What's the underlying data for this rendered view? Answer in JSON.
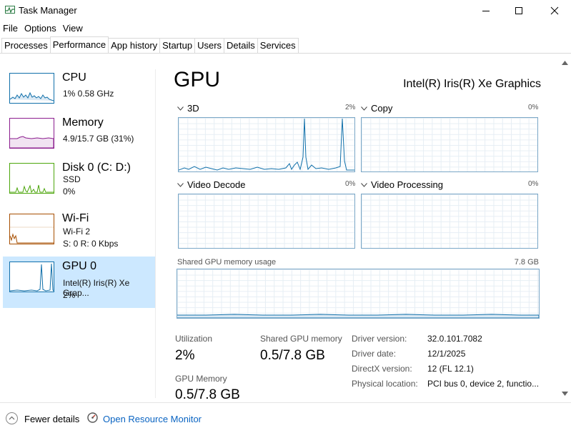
{
  "window": {
    "title": "Task Manager",
    "app_icon": "task-manager-icon",
    "controls": [
      "minimize-icon",
      "maximize-icon",
      "close-icon"
    ]
  },
  "menu": [
    "File",
    "Options",
    "View"
  ],
  "tabs": [
    "Processes",
    "Performance",
    "App history",
    "Startup",
    "Users",
    "Details",
    "Services"
  ],
  "active_tab": "Performance",
  "sidebar": {
    "items": [
      {
        "title": "CPU",
        "line1": "1%  0.58 GHz",
        "line2": "",
        "line3": "",
        "color": "#1170aa"
      },
      {
        "title": "Memory",
        "line1": "4.9/15.7 GB (31%)",
        "line2": "",
        "line3": "",
        "color": "#8b1d8e"
      },
      {
        "title": "Disk 0 (C: D:)",
        "line1": "SSD",
        "line2": "0%",
        "line3": "",
        "color": "#4da60c"
      },
      {
        "title": "Wi-Fi",
        "line1": "Wi-Fi 2",
        "line2": "S: 0  R: 0 Kbps",
        "line3": "",
        "color": "#a74f01"
      },
      {
        "title": "GPU 0",
        "line1": "Intel(R) Iris(R) Xe Grap...",
        "line2": "2%",
        "line3": "",
        "color": "#1170aa"
      }
    ],
    "selected": "GPU 0"
  },
  "main": {
    "title": "GPU",
    "model": "Intel(R) Iris(R) Xe Graphics",
    "engines": [
      {
        "name": "3D",
        "percent": "2%"
      },
      {
        "name": "Copy",
        "percent": "0%"
      },
      {
        "name": "Video Decode",
        "percent": "0%"
      },
      {
        "name": "Video Processing",
        "percent": "0%"
      }
    ],
    "shared_memory_label": "Shared GPU memory usage",
    "shared_memory_max": "7.8 GB",
    "stats": {
      "utilization_label": "Utilization",
      "utilization_value": "2%",
      "shared_label": "Shared GPU memory",
      "shared_value": "0.5/7.8 GB",
      "gpu_memory_label": "GPU Memory",
      "gpu_memory_value": "0.5/7.8 GB"
    },
    "details": [
      {
        "label": "Driver version:",
        "value": "32.0.101.7082"
      },
      {
        "label": "Driver date:",
        "value": "12/1/2025"
      },
      {
        "label": "DirectX version:",
        "value": "12 (FL 12.1)"
      },
      {
        "label": "Physical location:",
        "value": "PCI bus 0, device 2, functio..."
      }
    ]
  },
  "footer": {
    "fewer_details": "Fewer details",
    "open_monitor": "Open Resource Monitor"
  },
  "colors": {
    "selected_bg": "#cce8ff",
    "graph_line": "#1170aa",
    "link": "#0a64c2"
  }
}
